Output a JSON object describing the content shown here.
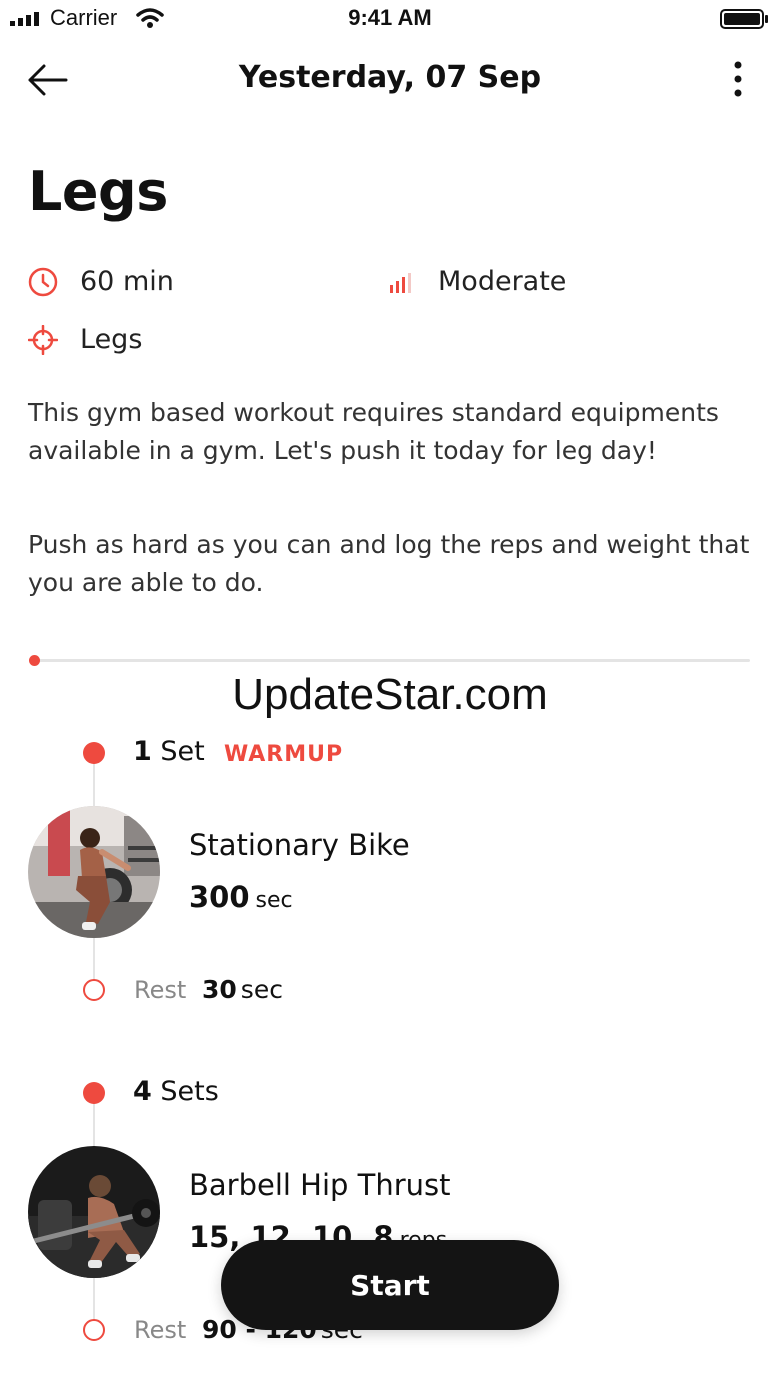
{
  "status_bar": {
    "carrier": "Carrier",
    "time": "9:41 AM"
  },
  "nav": {
    "title": "Yesterday, 07 Sep",
    "back_icon": "arrow-left-icon",
    "more_icon": "more-vertical-icon"
  },
  "workout": {
    "title": "Legs",
    "duration": "60 min",
    "difficulty": "Moderate",
    "target": "Legs",
    "description_1": "This gym based workout requires standard equipments available in a gym. Let's push it today for leg day!",
    "description_2": "Push as hard as you can and log the reps and weight that you are able to do."
  },
  "progress": {
    "fraction": 0.0
  },
  "watermark": "UpdateStar.com",
  "exercises": [
    {
      "sets_count": "1",
      "sets_word": "Set",
      "tag": "WARMUP",
      "name": "Stationary Bike",
      "amount": "300",
      "unit": "sec",
      "rest_label": "Rest",
      "rest_value": "30",
      "rest_unit": "sec"
    },
    {
      "sets_count": "4",
      "sets_word": "Sets",
      "name": "Barbell Hip Thrust",
      "amount": "15, 12, 10, 8",
      "unit": "reps",
      "rest_label": "Rest",
      "rest_value": "90 - 120",
      "rest_unit": "sec"
    }
  ],
  "start_button": {
    "label": "Start"
  },
  "colors": {
    "accent": "#ee4a3f",
    "button": "#141414",
    "muted": "#888888"
  }
}
